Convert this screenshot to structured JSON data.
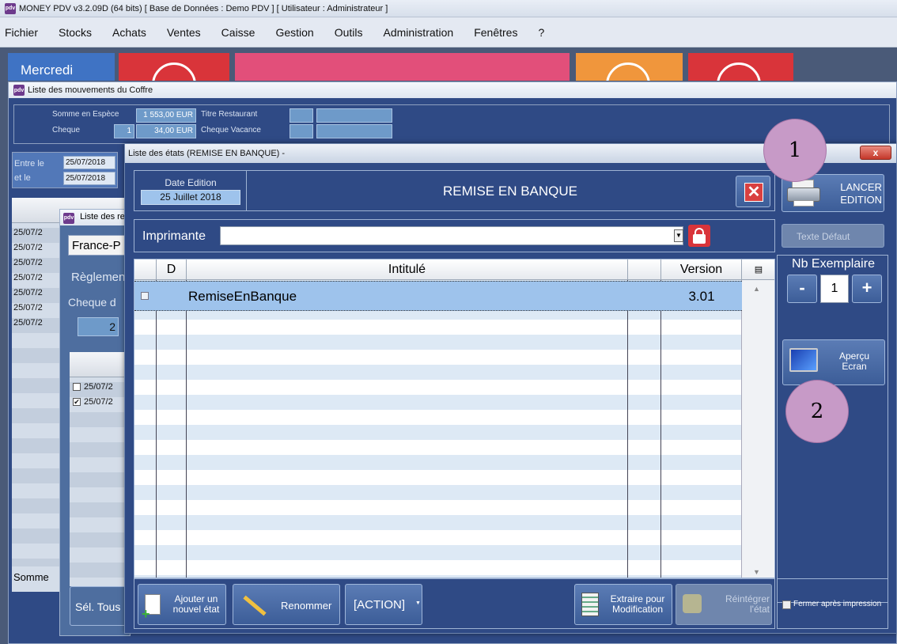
{
  "app": {
    "title": "MONEY PDV v3.2.09D (64 bits) [ Base de Données : Demo PDV ] [ Utilisateur : Administrateur ]",
    "logo": "pdv"
  },
  "menu": [
    "Fichier",
    "Stocks",
    "Achats",
    "Ventes",
    "Caisse",
    "Gestion",
    "Outils",
    "Administration",
    "Fenêtres",
    "?"
  ],
  "dashboard": {
    "day_label": "Mercredi"
  },
  "coffre": {
    "title": "Liste des mouvements du Coffre",
    "somme_espece_label": "Somme en Espèce",
    "somme_espece_value": "1 553,00 EUR",
    "titre_restaurant_label": "Titre Restaurant",
    "cheque_label": "Cheque",
    "cheque_count": "1",
    "cheque_value": "34,00 EUR",
    "cheque_vacance_label": "Cheque Vacance",
    "entre_le_label": "Entre le",
    "et_le_label": "et le",
    "date_from": "25/07/2018",
    "date_to": "25/07/2018",
    "rows": [
      "25/07/2",
      "25/07/2",
      "25/07/2",
      "25/07/2",
      "25/07/2",
      "25/07/2",
      "25/07/2"
    ],
    "somme_label": "Somme",
    "sel_tous_label": "Sél. Tous"
  },
  "remises": {
    "title": "Liste des re",
    "bank": "France-P",
    "reglement_label": "Règlemen",
    "cheque_group_label": "Cheque d",
    "count": "2",
    "rows": [
      {
        "checked": false,
        "date": "25/07/2"
      },
      {
        "checked": true,
        "date": "25/07/2"
      }
    ]
  },
  "etats": {
    "title": "Liste des états (REMISE EN BANQUE) -",
    "close_label": "x",
    "date_edition_label": "Date Edition",
    "date_edition_value": "25 Juillet 2018",
    "heading": "REMISE EN BANQUE",
    "lancer_label": "LANCER",
    "edition_label": "EDITION",
    "imprimante_label": "Imprimante",
    "imprimante_value": "",
    "texte_defaut_label": "Texte Défaut",
    "nb_exemplaire_label": "Nb Exemplaire",
    "nb_exemplaire_value": "1",
    "minus_label": "-",
    "plus_label": "+",
    "apercu_label": "Aperçu",
    "ecran_label": "Ecran",
    "columns": {
      "d": "D",
      "intitule": "Intitulé",
      "version": "Version"
    },
    "rows": [
      {
        "intitule": "RemiseEnBanque",
        "version": "3.01"
      }
    ],
    "ajouter_line1": "Ajouter un",
    "ajouter_line2": "nouvel état",
    "renommer_label": "Renommer",
    "action_label": "[ACTION]",
    "extraire_line1": "Extraire pour",
    "extraire_line2": "Modification",
    "reintegrer_line1": "Réintégrer",
    "reintegrer_line2": "l'état",
    "fermer_label": "Fermer après impression"
  },
  "annotations": {
    "one": "1",
    "two": "2"
  },
  "colors": {
    "accent_blue": "#2f4a85",
    "selection": "#9ec3ec",
    "red": "#d9343a",
    "pink": "#e24f7a",
    "orange": "#f0963c"
  }
}
